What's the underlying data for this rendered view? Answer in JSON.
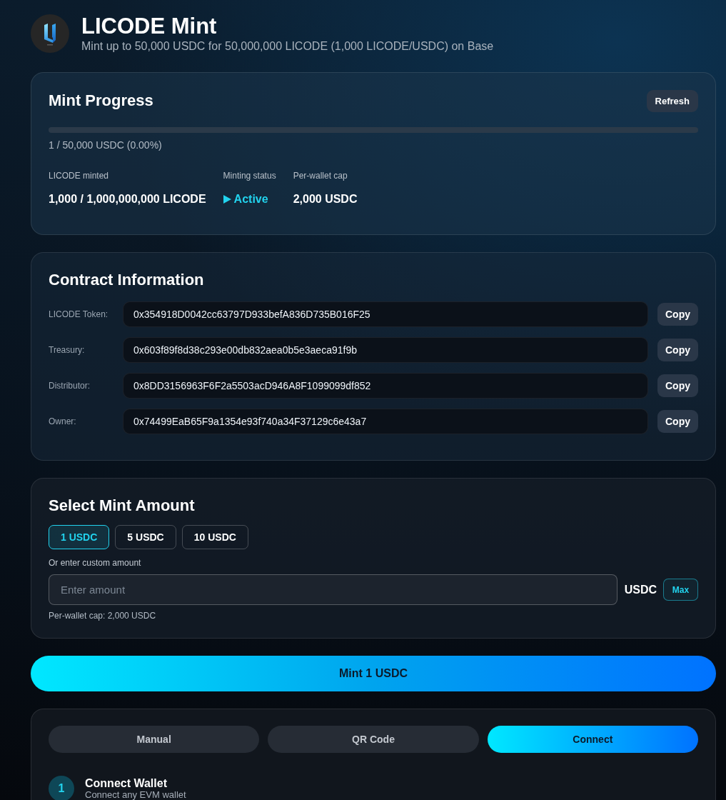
{
  "header": {
    "title": "LICODE Mint",
    "subtitle": "Mint up to 50,000 USDC for 50,000,000 LICODE (1,000 LICODE/USDC) on Base"
  },
  "progress": {
    "title": "Mint Progress",
    "refresh_label": "Refresh",
    "level": 2e-05,
    "summary": "1 / 50,000 USDC (0.00%)",
    "stats": [
      {
        "kind": "text",
        "label": "LICODE minted",
        "value": "1,000 / 1,000,000,000 LICODE"
      },
      {
        "kind": "status",
        "label": "Minting status",
        "value": "Active",
        "active": true
      },
      {
        "kind": "text",
        "label": "Per-wallet cap",
        "value": "2,000 USDC"
      }
    ]
  },
  "contract": {
    "title": "Contract Information",
    "rows": [
      {
        "label": "LICODE Token:",
        "value": "0x354918D0042cc63797D933befA836D735B016F25",
        "button": "Copy"
      },
      {
        "label": "Treasury:",
        "value": "0x603f89f8d38c293e00db832aea0b5e3aeca91f9b",
        "button": "Copy"
      },
      {
        "label": "Distributor:",
        "value": "0x8DD3156963F6F2a5503acD946A8F1099099df852",
        "button": "Copy"
      },
      {
        "label": "Owner:",
        "value": "0x74499EaB65F9a1354e93f740a34F37129c6e43a7",
        "button": "Copy"
      }
    ]
  },
  "amount": {
    "title": "Select Mint Amount",
    "presets": [
      {
        "label": "1 USDC",
        "selected": true
      },
      {
        "label": "5 USDC",
        "selected": false
      },
      {
        "label": "10 USDC",
        "selected": false
      }
    ],
    "custom_label": "Or enter custom amount",
    "input": {
      "placeholder": "Enter amount"
    },
    "unit": "USDC",
    "max_label": "Max",
    "cap_note": "Per-wallet cap: 2,000 USDC"
  },
  "mint_button": "Mint 1 USDC",
  "wallet": {
    "tabs": [
      {
        "label": "Manual",
        "selected": false
      },
      {
        "label": "QR Code",
        "selected": false
      },
      {
        "label": "Connect",
        "selected": true
      }
    ],
    "steps": [
      {
        "number": "1",
        "title": "Connect Wallet",
        "subtitle": "Connect any EVM wallet"
      }
    ]
  }
}
